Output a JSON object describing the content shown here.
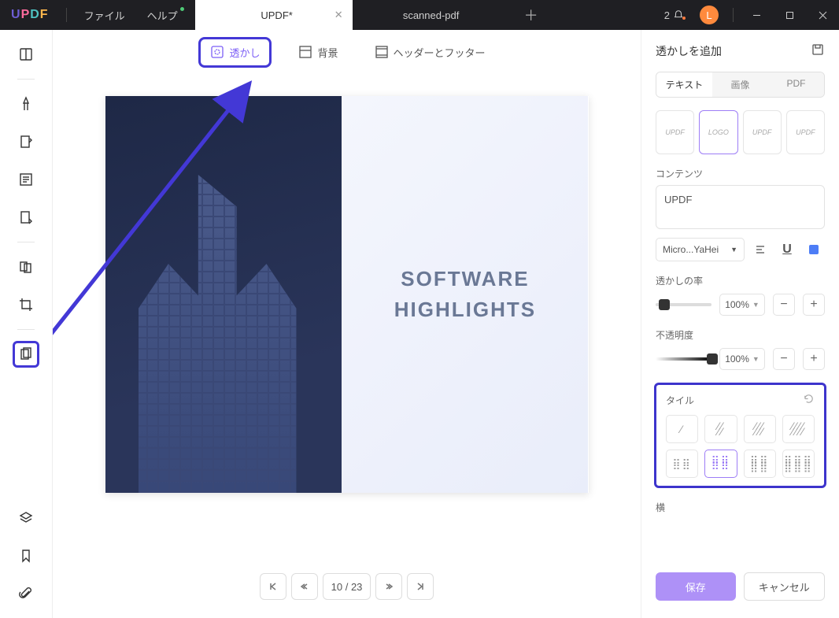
{
  "menu": {
    "file": "ファイル",
    "help": "ヘルプ"
  },
  "tabs": {
    "active": "UPDF*",
    "inactive": "scanned-pdf"
  },
  "notif_count": "2",
  "avatar_letter": "L",
  "toolbar": {
    "watermark": "透かし",
    "background": "背景",
    "headerfooter": "ヘッダーとフッター"
  },
  "page": {
    "headline1": "SOFTWARE",
    "headline2": "HIGHLIGHTS"
  },
  "pager": {
    "current": "10",
    "sep": "/",
    "total": "23"
  },
  "panel": {
    "title": "透かしを追加",
    "type_text": "テキスト",
    "type_image": "画像",
    "type_pdf": "PDF",
    "preset1": "UPDF",
    "preset2": "LOGO",
    "preset3": "UPDF",
    "preset4": "UPDF",
    "content_label": "コンテンツ",
    "content_value": "UPDF",
    "font_name": "Micro...YaHei",
    "ratio_label": "透かしの率",
    "ratio_value": "100%",
    "opacity_label": "不透明度",
    "opacity_value": "100%",
    "tile_label": "タイル",
    "horizontal_label": "横",
    "save": "保存",
    "cancel": "キャンセル"
  }
}
